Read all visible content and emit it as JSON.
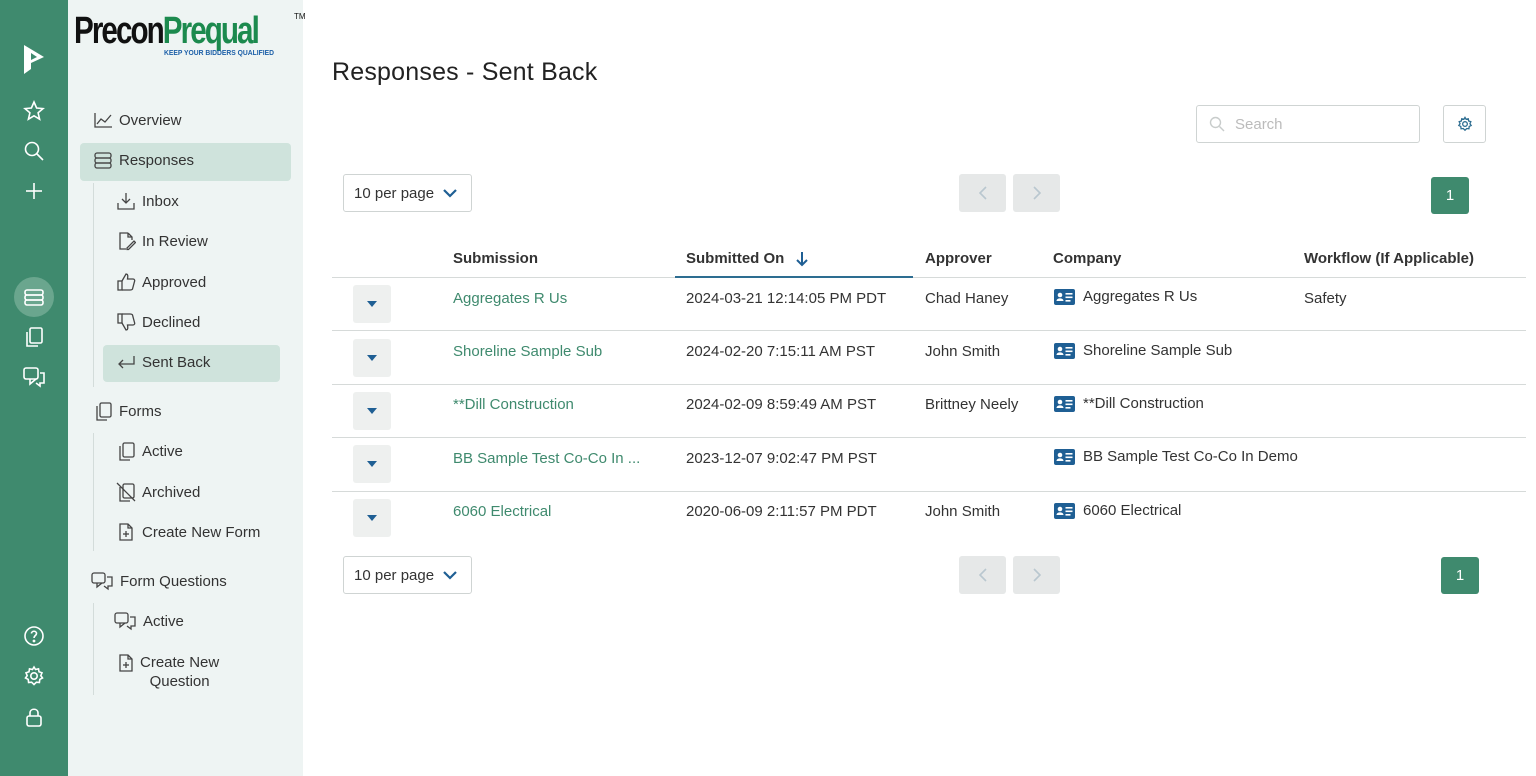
{
  "rail": {
    "icons": [
      "app-logo-icon",
      "star-icon",
      "search-icon",
      "plus-icon",
      "inbox-stack-icon",
      "copy-icon",
      "question-chat-icon",
      "help-icon",
      "gear-icon",
      "lock-icon"
    ]
  },
  "logo": {
    "part1": "Precon",
    "part2": "Prequal",
    "tm": "TM",
    "tagline": "KEEP YOUR BIDDERS QUALIFIED"
  },
  "sidebar": {
    "overview": "Overview",
    "responses": "Responses",
    "responses_items": [
      "Inbox",
      "In Review",
      "Approved",
      "Declined",
      "Sent Back"
    ],
    "forms": "Forms",
    "forms_items": [
      "Active",
      "Archived",
      "Create New Form"
    ],
    "form_questions": "Form Questions",
    "form_questions_items": [
      "Active",
      "Create New",
      "Question"
    ]
  },
  "page": {
    "title": "Responses - Sent Back",
    "search_placeholder": "Search",
    "per_page": "10 per page",
    "page_number": "1"
  },
  "table": {
    "headers": [
      "Submission",
      "Submitted On",
      "Approver",
      "Company",
      "Workflow (If Applicable)"
    ],
    "rows": [
      {
        "submission": "Aggregates R Us",
        "submitted_on": "2024-03-21 12:14:05 PM PDT",
        "approver": "Chad Haney",
        "company": "Aggregates R Us",
        "workflow": "Safety"
      },
      {
        "submission": "Shoreline Sample Sub",
        "submitted_on": "2024-02-20 7:15:11 AM PST",
        "approver": "John Smith",
        "company": "Shoreline Sample Sub",
        "workflow": ""
      },
      {
        "submission": "**Dill Construction",
        "submitted_on": "2024-02-09 8:59:49 AM PST",
        "approver": "Brittney Neely",
        "company": "**Dill Construction",
        "workflow": ""
      },
      {
        "submission": "BB Sample Test Co-Co In ...",
        "submitted_on": "2023-12-07 9:02:47 PM PST",
        "approver": "",
        "company": "BB Sample Test Co-Co In Demo",
        "workflow": ""
      },
      {
        "submission": "6060 Electrical",
        "submitted_on": "2020-06-09 2:11:57 PM PDT",
        "approver": "John Smith",
        "company": "6060 Electrical",
        "workflow": ""
      }
    ]
  }
}
